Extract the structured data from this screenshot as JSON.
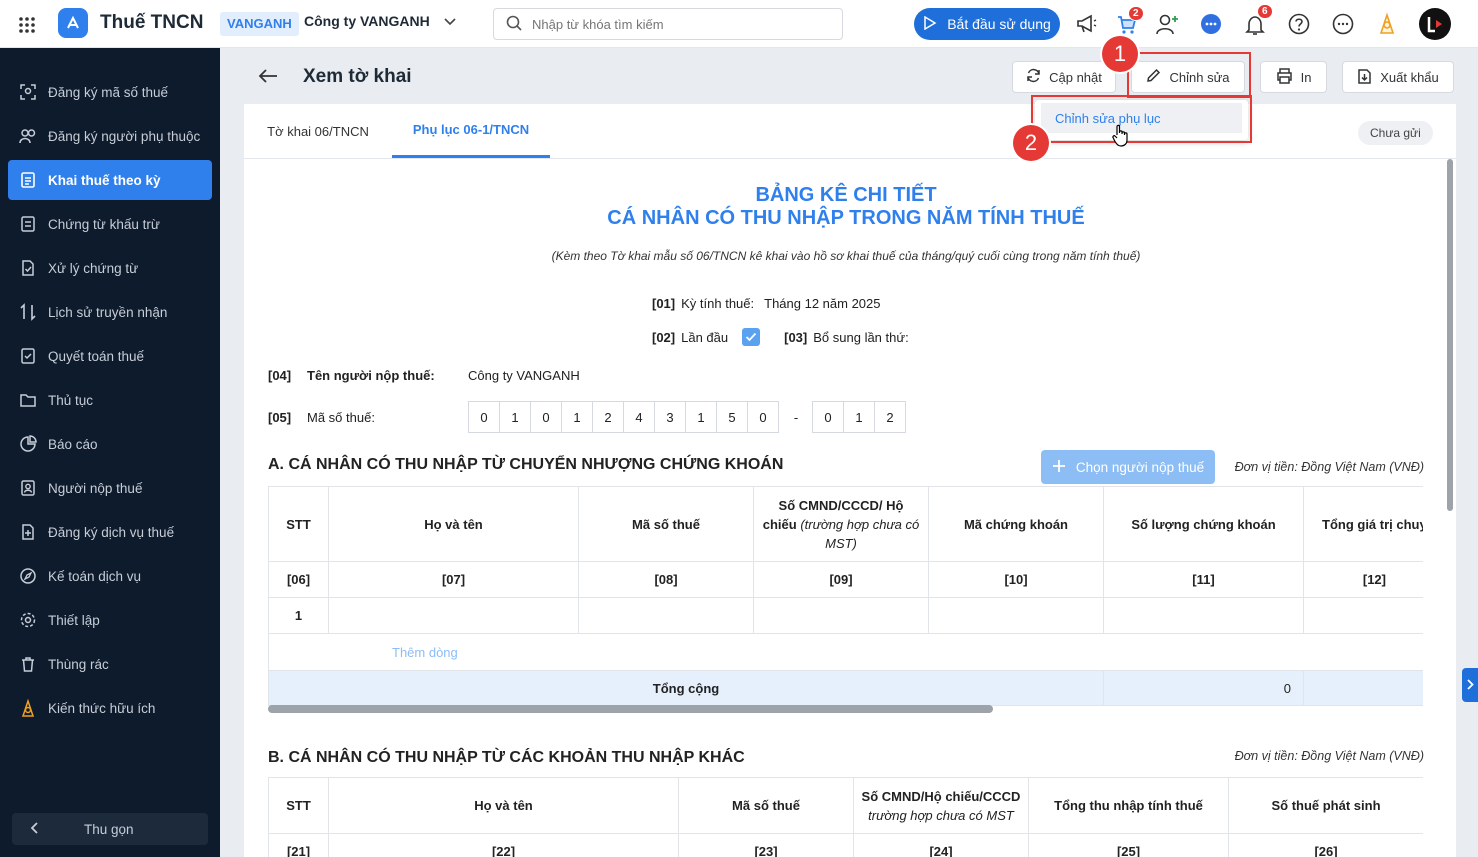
{
  "header": {
    "app_title": "Thuế TNCN",
    "org_code": "VANGANH",
    "company_name": "Công ty VANGANH",
    "search_placeholder": "Nhập từ khóa tìm kiếm",
    "start_button": "Bắt đầu sử dụng",
    "cart_badge": "2",
    "notification_badge": "6"
  },
  "sidebar": {
    "items": [
      {
        "label": "Đăng ký mã số thuế"
      },
      {
        "label": "Đăng ký người phụ thuộc"
      },
      {
        "label": "Khai thuế theo kỳ"
      },
      {
        "label": "Chứng từ khấu trừ"
      },
      {
        "label": "Xử lý chứng từ"
      },
      {
        "label": "Lịch sử truyền nhận"
      },
      {
        "label": "Quyết toán thuế"
      },
      {
        "label": "Thủ tục"
      },
      {
        "label": "Báo cáo"
      },
      {
        "label": "Người nộp thuế"
      },
      {
        "label": "Đăng ký dịch vụ thuế"
      },
      {
        "label": "Kế toán dịch vụ"
      },
      {
        "label": "Thiết lập"
      },
      {
        "label": "Thùng rác"
      },
      {
        "label": "Kiến thức hữu ích"
      }
    ],
    "collapse_label": "Thu gọn"
  },
  "page": {
    "title": "Xem tờ khai",
    "actions": {
      "update": "Cập nhật",
      "edit": "Chỉnh sửa",
      "print": "In",
      "export": "Xuất khẩu"
    },
    "dropdown_item": "Chỉnh sửa phụ lục",
    "callouts": [
      "1",
      "2"
    ],
    "tabs": [
      {
        "label": "Tờ khai 06/TNCN"
      },
      {
        "label": "Phụ lục 06-1/TNCN"
      }
    ],
    "status": "Chưa gửi"
  },
  "form": {
    "title_line1": "BẢNG KÊ CHI TIẾT",
    "title_line2": "CÁ NHÂN CÓ THU NHẬP TRONG NĂM TÍNH THUẾ",
    "subtitle": "(Kèm theo Tờ khai mẫu số 06/TNCN kê khai vào hồ sơ khai thuế của tháng/quý cuối cùng trong năm tính thuế)",
    "f01_code": "[01]",
    "f01_label": "Kỳ tính thuế:",
    "f01_value": "Tháng 12 năm 2025",
    "f02_code": "[02]",
    "f02_label": "Lần đầu",
    "f03_code": "[03]",
    "f03_label": "Bổ sung lần thứ:",
    "f04_code": "[04]",
    "f04_label": "Tên người nộp thuế:",
    "f04_value": "Công ty VANGANH",
    "f05_code": "[05]",
    "f05_label": "Mã số thuế:",
    "tax_digits": [
      "0",
      "1",
      "0",
      "1",
      "2",
      "4",
      "3",
      "1",
      "5",
      "0"
    ],
    "tax_sep": "-",
    "tax_suffix": [
      "0",
      "1",
      "2"
    ]
  },
  "section_a": {
    "title": "A. CÁ NHÂN CÓ THU NHẬP TỪ CHUYỂN NHƯỢNG CHỨNG KHOÁN",
    "choose_button": "Chọn người nộp thuế",
    "unit": "Đơn vị tiền: Đồng Việt Nam (VNĐ)",
    "headers": [
      "STT",
      "Họ và tên",
      "Mã số thuế",
      "Số CMND/CCCD/ Hộ",
      "chiếu",
      " (trường hợp chưa có MST)",
      "Mã chứng khoán",
      "Số lượng chứng khoán",
      "Tổng giá trị chuyển nhượng"
    ],
    "codes": [
      "[06]",
      "[07]",
      "[08]",
      "[09]",
      "[10]",
      "[11]",
      "[12]"
    ],
    "row_stt": "1",
    "add_row": "Thêm dòng",
    "total_label": "Tổng cộng",
    "total_value": "0"
  },
  "section_b": {
    "title": "B. CÁ NHÂN CÓ THU NHẬP TỪ CÁC KHOẢN THU NHẬP KHÁC",
    "unit": "Đơn vị tiền: Đồng Việt Nam (VNĐ)",
    "headers": [
      "STT",
      "Họ và tên",
      "Mã số thuế",
      "Số CMND/Hộ chiếu/CCCD",
      "trường hợp chưa có MST",
      "Tổng thu nhập tính thuế",
      "Số thuế phát sinh"
    ],
    "codes": [
      "[21]",
      "[22]",
      "[23]",
      "[24]",
      "[25]",
      "[26]"
    ]
  }
}
